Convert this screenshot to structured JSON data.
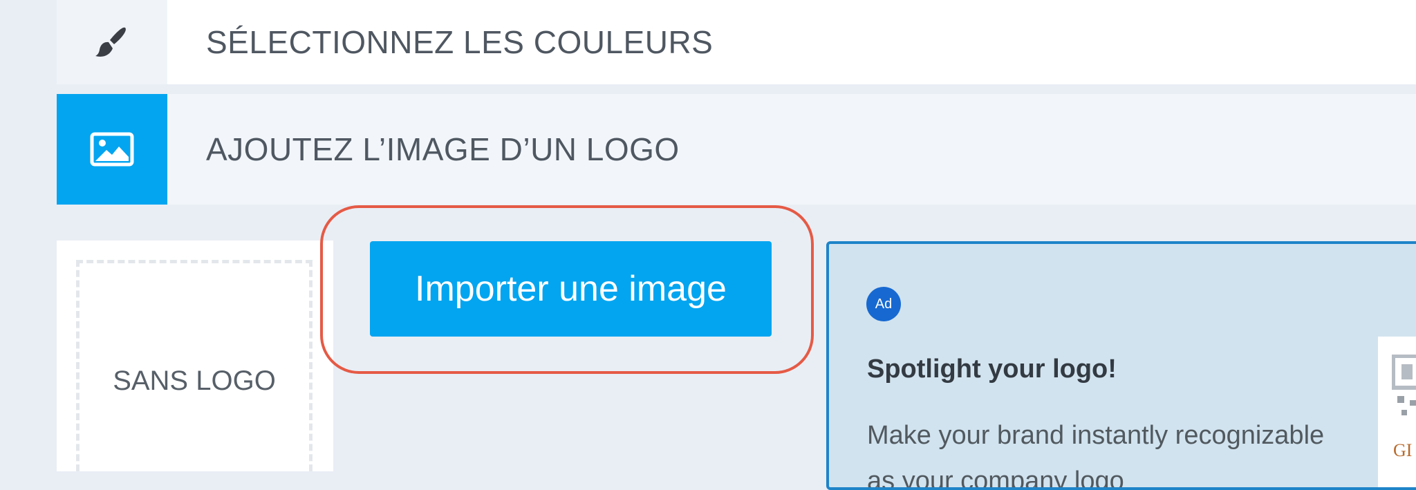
{
  "sections": [
    {
      "label": "SÉLECTIONNEZ LES COULEURS",
      "icon": "paintbrush-icon"
    },
    {
      "label": "AJOUTEZ L’IMAGE D’UN LOGO",
      "icon": "image-icon"
    }
  ],
  "logo": {
    "no_logo_label": "SANS LOGO",
    "import_button_label": "Importer une image"
  },
  "ad": {
    "badge": "Ad",
    "title": "Spotlight your logo!",
    "body": "Make your brand instantly recognizable as your company logo",
    "thumb_text": "GI"
  },
  "colors": {
    "accent": "#04a5f0",
    "highlight": "#e55a45",
    "ad_background": "#d1e3ef",
    "ad_border": "#1e84c8",
    "ad_badge": "#1769d1"
  }
}
